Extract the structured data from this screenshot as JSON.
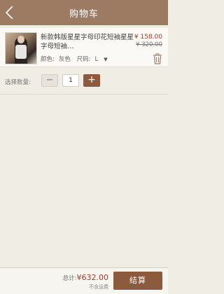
{
  "header": {
    "title": "购物车",
    "back_icon": "chevron-left-icon"
  },
  "item": {
    "name": "新款韩版星星字母印花短袖星星字母短袖…",
    "color_label": "颜色:",
    "color_value": "灰色",
    "size_label": "尺码:",
    "size_value": "L",
    "price": "¥ 158.00",
    "original_price": "¥ 320.00",
    "delete_icon": "trash-icon"
  },
  "quantity": {
    "label": "选择数量:",
    "minus": "−",
    "value": "1",
    "plus": "+"
  },
  "footer": {
    "total_label": "总计:",
    "total_amount": "¥632.00",
    "tax_note": "不含运费",
    "checkout_label": "结算"
  },
  "colors": {
    "header": "#9c7b62",
    "accent": "#8c5a3d",
    "price": "#a23b2a",
    "background": "#f0ede4"
  }
}
